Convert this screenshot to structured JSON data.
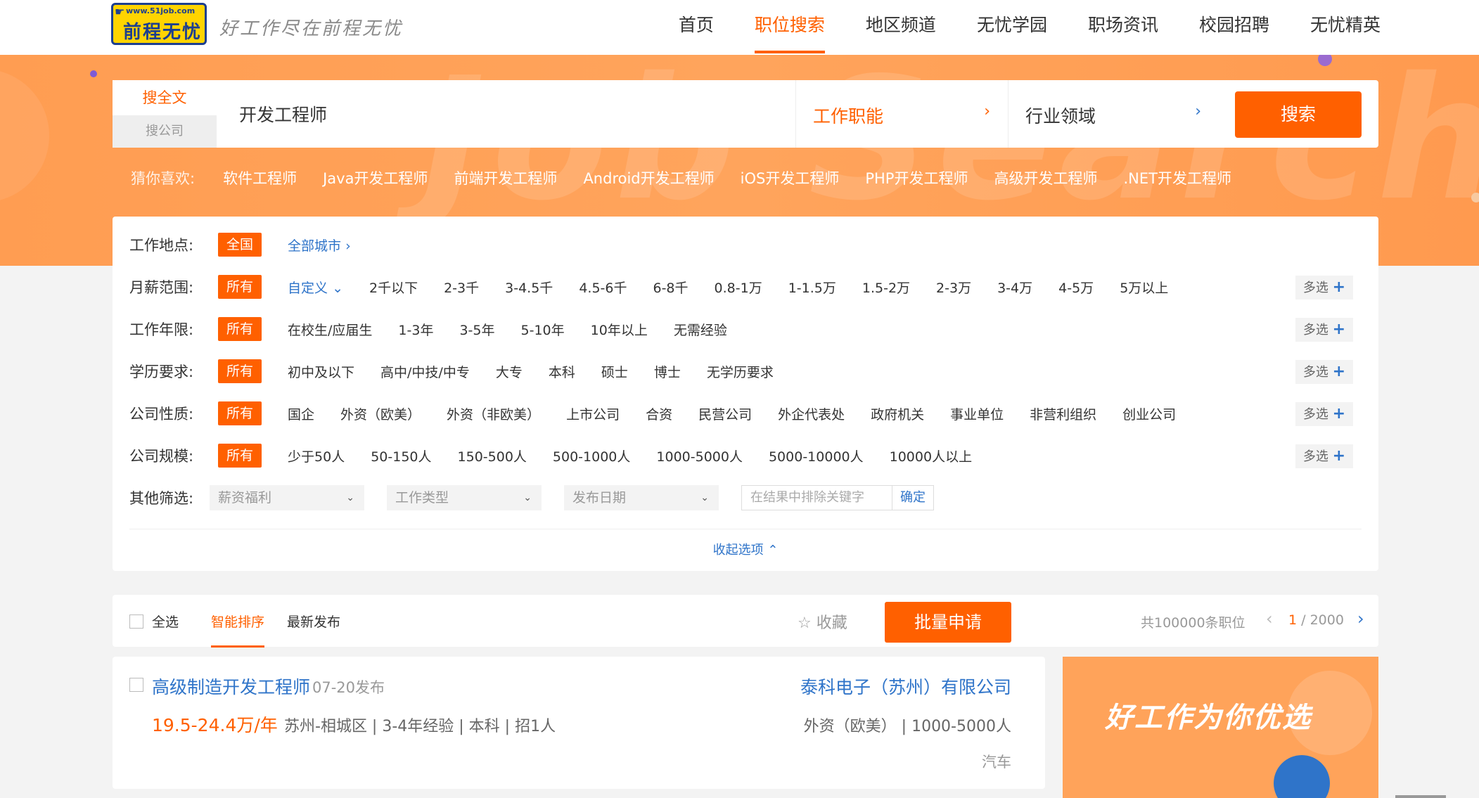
{
  "brand": {
    "url": "www.51job.com",
    "name": "前程无忧",
    "slogan": "好工作尽在前程无忧"
  },
  "nav": [
    {
      "label": "首页",
      "active": false
    },
    {
      "label": "职位搜索",
      "active": true
    },
    {
      "label": "地区频道",
      "active": false
    },
    {
      "label": "无忧学园",
      "active": false
    },
    {
      "label": "职场资讯",
      "active": false
    },
    {
      "label": "校园招聘",
      "active": false
    },
    {
      "label": "无忧精英",
      "active": false
    }
  ],
  "hero": {
    "watermark": "Job Search"
  },
  "search": {
    "tab_fulltext": "搜全文",
    "tab_company": "搜公司",
    "query": "开发工程师",
    "function_label": "工作职能",
    "industry_label": "行业领域",
    "button": "搜索"
  },
  "guess": {
    "label": "猜你喜欢:",
    "items": [
      "软件工程师",
      "Java开发工程师",
      "前端开发工程师",
      "Android开发工程师",
      "iOS开发工程师",
      "PHP开发工程师",
      "高级开发工程师",
      ".NET开发工程师"
    ]
  },
  "filters": {
    "location": {
      "label": "工作地点:",
      "selected": "全国",
      "all_cities": "全部城市"
    },
    "salary": {
      "label": "月薪范围:",
      "selected": "所有",
      "custom": "自定义",
      "options": [
        "2千以下",
        "2-3千",
        "3-4.5千",
        "4.5-6千",
        "6-8千",
        "0.8-1万",
        "1-1.5万",
        "1.5-2万",
        "2-3万",
        "3-4万",
        "4-5万",
        "5万以上"
      ]
    },
    "experience": {
      "label": "工作年限:",
      "selected": "所有",
      "options": [
        "在校生/应届生",
        "1-3年",
        "3-5年",
        "5-10年",
        "10年以上",
        "无需经验"
      ]
    },
    "education": {
      "label": "学历要求:",
      "selected": "所有",
      "options": [
        "初中及以下",
        "高中/中技/中专",
        "大专",
        "本科",
        "硕士",
        "博士",
        "无学历要求"
      ]
    },
    "company_type": {
      "label": "公司性质:",
      "selected": "所有",
      "options": [
        "国企",
        "外资（欧美）",
        "外资（非欧美）",
        "上市公司",
        "合资",
        "民营公司",
        "外企代表处",
        "政府机关",
        "事业单位",
        "非营利组织",
        "创业公司"
      ]
    },
    "company_size": {
      "label": "公司规模:",
      "selected": "所有",
      "options": [
        "少于50人",
        "50-150人",
        "150-500人",
        "500-1000人",
        "1000-5000人",
        "5000-10000人",
        "10000人以上"
      ]
    },
    "other": {
      "label": "其他筛选:",
      "dropdowns": [
        "薪资福利",
        "工作类型",
        "发布日期"
      ],
      "exclude_placeholder": "在结果中排除关键字",
      "confirm": "确定"
    },
    "multi_label": "多选",
    "collapse": "收起选项"
  },
  "results": {
    "select_all": "全选",
    "sort_smart": "智能排序",
    "sort_latest": "最新发布",
    "favorite": "收藏",
    "batch_apply": "批量申请",
    "total": "共100000条职位",
    "page_current": "1",
    "page_total": "/ 2000"
  },
  "job": {
    "title": "高级制造开发工程师",
    "date": "07-20发布",
    "salary": "19.5-24.4万/年",
    "meta": "苏州-相城区 | 3-4年经验 | 本科 | 招1人",
    "company": "泰科电子（苏州）有限公司",
    "company_info": "外资（欧美） | 1000-5000人",
    "industry": "汽车"
  },
  "ad": {
    "text": "好工作为你优选"
  },
  "colors": {
    "accent": "#ff6000",
    "link": "#2f74c9",
    "hero": "#ffa35a"
  }
}
